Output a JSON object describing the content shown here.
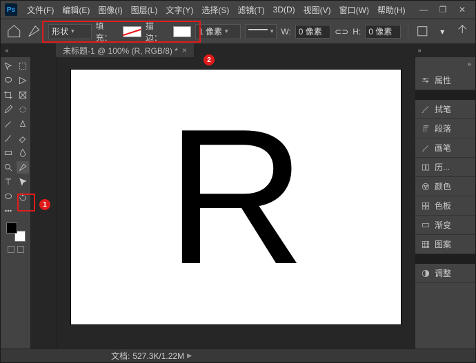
{
  "menu": {
    "items": [
      "文件(F)",
      "编辑(E)",
      "图像(I)",
      "图层(L)",
      "文字(Y)",
      "选择(S)",
      "滤镜(T)",
      "3D(D)",
      "视图(V)",
      "窗口(W)",
      "帮助(H)"
    ]
  },
  "window_ctrl": {
    "min": "—",
    "max": "❐",
    "close": "✕"
  },
  "options": {
    "shape_mode": "形状",
    "fill_label": "填充：",
    "stroke_label": "描边：",
    "stroke_width": "1 像素",
    "w_label": "W:",
    "w_value": "0 像素",
    "link": "⊂⊃",
    "h_label": "H:",
    "h_value": "0 像素"
  },
  "doc_tab": {
    "title": "未标题-1 @ 100% (R, RGB/8) *"
  },
  "annotations": {
    "one": "1",
    "two": "2"
  },
  "canvas_text": "R",
  "status": {
    "label": "文档:",
    "value": "527.3K/1.22M"
  },
  "panels": {
    "properties": "属性",
    "brush_presets": "拭笔",
    "paragraph": "段落",
    "brush": "画笔",
    "history": "历...",
    "color": "颜色",
    "swatches": "色板",
    "gradient": "渐变",
    "pattern": "图案",
    "adjustments": "调整"
  },
  "tool_names": [
    "move",
    "artboard",
    "marquee",
    "lasso",
    "quick-select",
    "crop",
    "frame",
    "eyedropper",
    "patch",
    "brush",
    "clone",
    "history-brush",
    "eraser",
    "gradient",
    "paint-bucket",
    "blur",
    "dodge",
    "pen",
    "curvature",
    "type",
    "path-select",
    "rectangle",
    "hand",
    "zoom"
  ]
}
